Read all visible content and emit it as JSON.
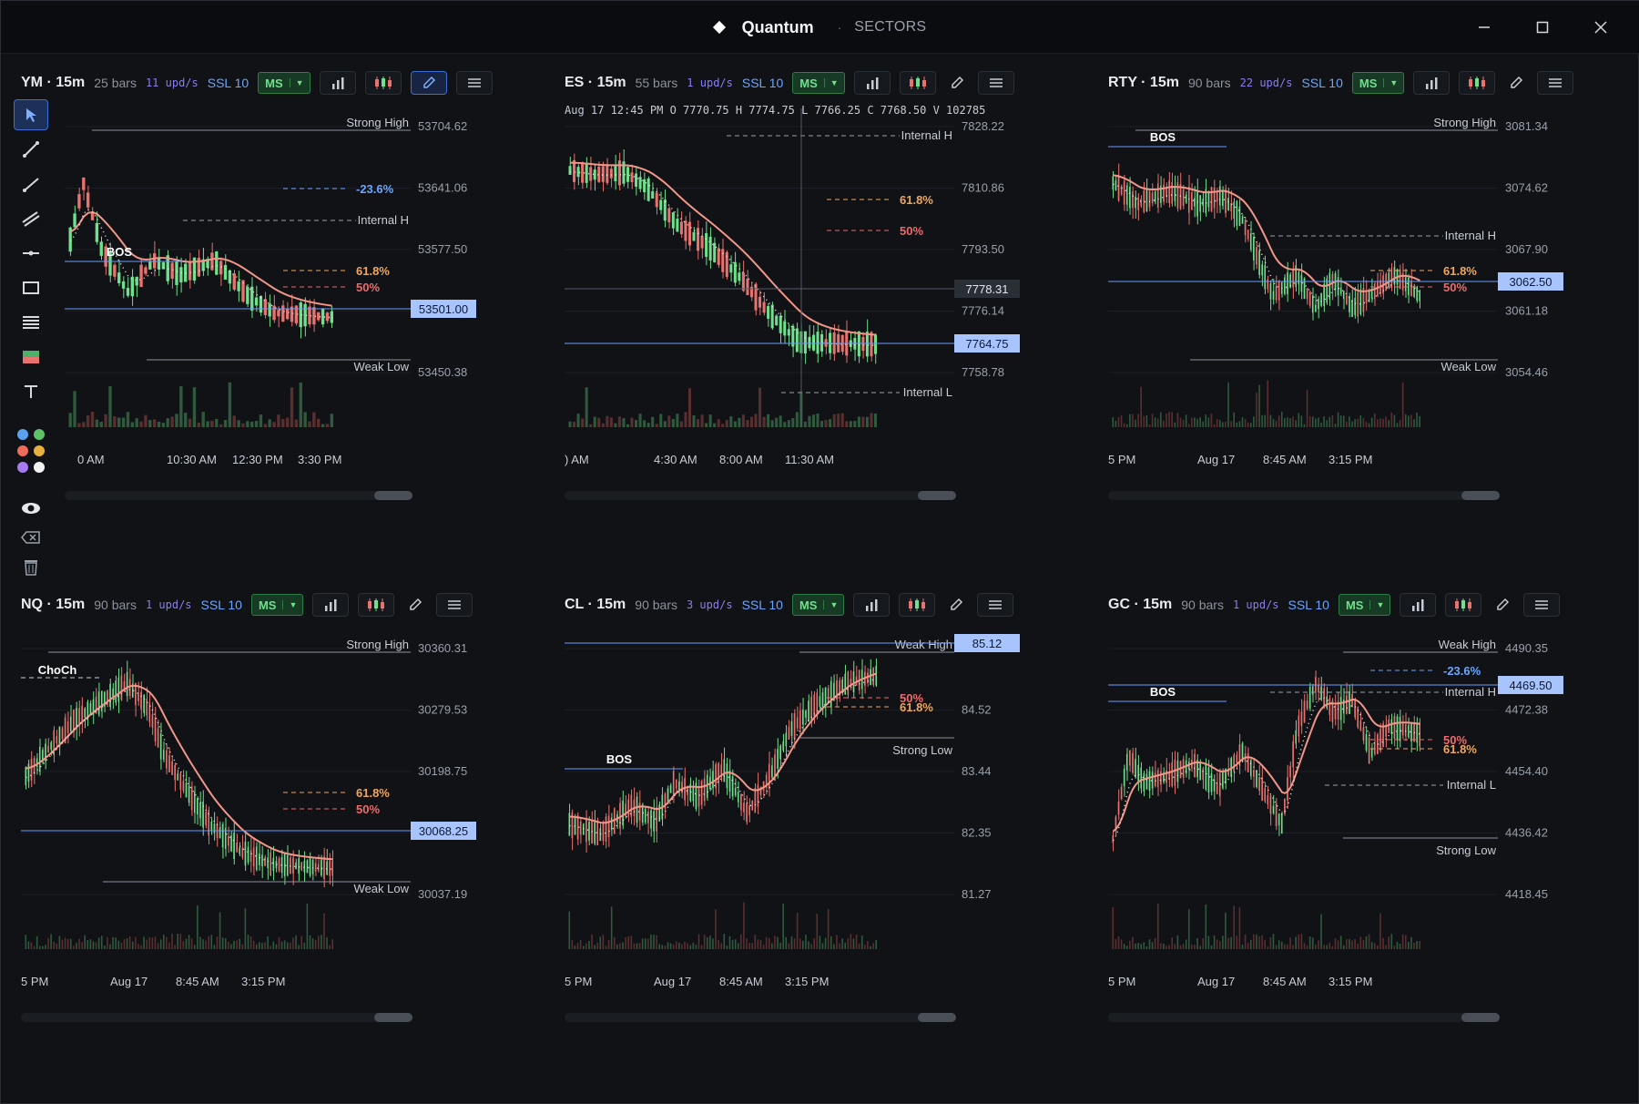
{
  "app": {
    "title": "Quantum",
    "separator": "·",
    "section": "SECTORS",
    "window_controls": [
      "minimize-icon",
      "maximize-icon",
      "close-icon"
    ]
  },
  "colors": {
    "background": "#101216",
    "up": "#6fe08b",
    "down": "#e8736e",
    "ema": "#f19688",
    "support_line": "#6a9cff",
    "fib_618": "#f0a65a",
    "fib_50": "#ef6b6b",
    "fib_236": "#6aa6ff",
    "level_gray": "#9aa0ab",
    "accent": "#3b6fd8"
  },
  "toolbar": {
    "tools": [
      "cursor-icon",
      "trendline-icon",
      "ray-icon",
      "parallel-channel-icon",
      "horizontal-line-icon",
      "rectangle-icon",
      "fib-lines-icon",
      "position-icon",
      "text-icon"
    ],
    "palette": [
      "#5aa2f0",
      "#5cc36a",
      "#ef6b5a",
      "#e7b13c",
      "#a77bf0",
      "#f2f2f2"
    ],
    "extras": [
      "eye-icon",
      "eraser-icon",
      "trash-icon"
    ]
  },
  "panels": [
    {
      "symbol": "YM · 15m",
      "bars": "25 bars",
      "upd": "11 upd/s",
      "ssl": "SSL 10",
      "ms": "MS",
      "pencil_active": true,
      "price_axis": [
        "53704.62",
        "53641.06",
        "53577.50",
        "53513.94",
        "53450.38"
      ],
      "price_tag": "53501.00",
      "time_axis": [
        "0 AM",
        "10:30 AM",
        "12:30 PM",
        "3:30 PM"
      ],
      "labels": {
        "strong_high": "Strong High",
        "weak_low": "Weak Low",
        "internal_h": "Internal H",
        "bos": "BOS",
        "fib_236": "-23.6%",
        "fib_618": "61.8%",
        "fib_50": "50%"
      }
    },
    {
      "symbol": "ES · 15m",
      "bars": "55 bars",
      "upd": "1 upd/s",
      "ssl": "SSL 10",
      "ms": "MS",
      "pencil_active": false,
      "ohlc": "Aug 17 12:45 PM   O 7770.75   H 7774.75   L 7766.25   C 7768.50   V 102785",
      "price_axis": [
        "7828.22",
        "7810.86",
        "7793.50",
        "7776.14",
        "7758.78"
      ],
      "crosshair_tag": "7778.31",
      "price_tag": "7764.75",
      "time_axis": [
        ") AM",
        "4:30 AM",
        "8:00 AM",
        "11:30 AM"
      ],
      "labels": {
        "internal_h": "Internal H",
        "internal_l": "Internal L",
        "fib_618": "61.8%",
        "fib_50": "50%"
      }
    },
    {
      "symbol": "RTY · 15m",
      "bars": "90 bars",
      "upd": "22 upd/s",
      "ssl": "SSL 10",
      "ms": "MS",
      "pencil_active": false,
      "price_axis": [
        "3081.34",
        "3074.62",
        "3067.90",
        "3061.18",
        "3054.46"
      ],
      "price_tag": "3062.50",
      "time_axis": [
        "5 PM",
        "Aug 17",
        "8:45 AM",
        "3:15 PM"
      ],
      "labels": {
        "strong_high": "Strong High",
        "weak_low": "Weak Low",
        "internal_h": "Internal H",
        "bos": "BOS",
        "fib_618": "61.8%",
        "fib_50": "50%"
      }
    },
    {
      "symbol": "NQ · 15m",
      "bars": "90 bars",
      "upd": "1 upd/s",
      "ssl": "SSL 10",
      "ms": "MS",
      "pencil_active": false,
      "price_axis": [
        "30360.31",
        "30279.53",
        "30198.75",
        "30117.97",
        "30037.19"
      ],
      "price_tag": "30068.25",
      "time_axis": [
        "5 PM",
        "Aug 17",
        "8:45 AM",
        "3:15 PM"
      ],
      "labels": {
        "strong_high": "Strong High",
        "weak_low": "Weak Low",
        "choch": "ChoCh",
        "fib_618": "61.8%",
        "fib_50": "50%"
      }
    },
    {
      "symbol": "CL · 15m",
      "bars": "90 bars",
      "upd": "3 upd/s",
      "ssl": "SSL 10",
      "ms": "MS",
      "pencil_active": false,
      "price_axis": [
        "85.60",
        "84.52",
        "83.44",
        "82.35",
        "81.27"
      ],
      "price_tag": "85.12",
      "time_axis": [
        "5 PM",
        "Aug 17",
        "8:45 AM",
        "3:15 PM"
      ],
      "labels": {
        "weak_high": "Weak High",
        "strong_low": "Strong Low",
        "bos": "BOS",
        "fib_618": "61.8%",
        "fib_50": "50%"
      }
    },
    {
      "symbol": "GC · 15m",
      "bars": "90 bars",
      "upd": "1 upd/s",
      "ssl": "SSL 10",
      "ms": "MS",
      "pencil_active": false,
      "price_axis": [
        "4490.35",
        "4472.38",
        "4454.40",
        "4436.42",
        "4418.45"
      ],
      "price_tag": "4469.50",
      "time_axis": [
        "5 PM",
        "Aug 17",
        "8:45 AM",
        "3:15 PM"
      ],
      "labels": {
        "weak_high": "Weak High",
        "strong_low": "Strong Low",
        "internal_h": "Internal H",
        "internal_l": "Internal L",
        "bos": "BOS",
        "fib_236": "-23.6%",
        "fib_618": "61.8%",
        "fib_50": "50%"
      }
    }
  ]
}
